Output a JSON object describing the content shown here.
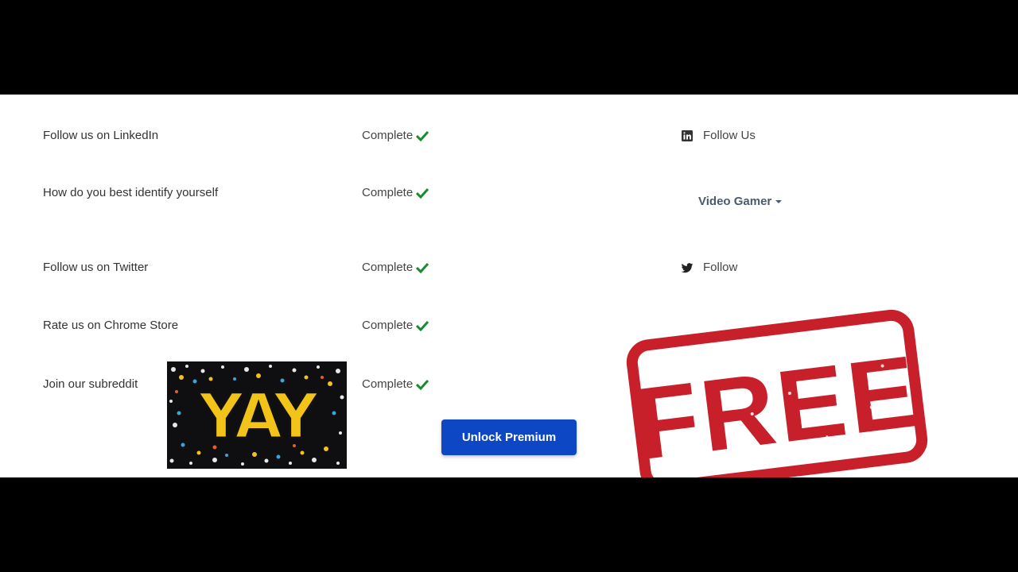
{
  "tasks": [
    {
      "label": "Follow us on LinkedIn",
      "status": "Complete"
    },
    {
      "label": "How do you best identify yourself",
      "status": "Complete"
    },
    {
      "label": "Follow us on Twitter",
      "status": "Complete"
    },
    {
      "label": "Rate us on Chrome Store",
      "status": "Complete"
    },
    {
      "label": "Join our subreddit",
      "status": "Complete"
    }
  ],
  "actions": {
    "linkedin": {
      "label": "Follow Us",
      "icon": "linkedin-icon"
    },
    "identity_dropdown": {
      "value": "Video Gamer",
      "icon": "caret-down-icon"
    },
    "twitter": {
      "label": "Follow",
      "icon": "twitter-icon"
    }
  },
  "unlock_button": {
    "label": "Unlock Premium"
  },
  "stickers": {
    "yay_text": "YAY",
    "stamp_text": "FREE"
  },
  "colors": {
    "accent": "#0d47c4",
    "check": "#1a8a2e",
    "stamp": "#c8202a",
    "bars": "#000000"
  }
}
